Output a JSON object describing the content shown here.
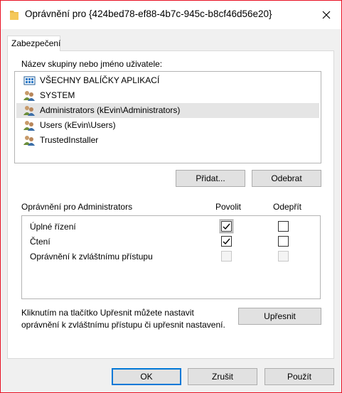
{
  "window": {
    "title": "Oprávnění pro {424bed78-ef88-4b7c-945c-b8cf46d56e20}",
    "icons": {
      "title": "folder-icon",
      "close": "close-icon"
    }
  },
  "tab": {
    "label": "Zabezpečení"
  },
  "groups": {
    "label": "Název skupiny nebo jméno uživatele:",
    "items": [
      {
        "name": "VŠECHNY BALÍČKY APLIKACÍ",
        "icon": "app-packages-icon",
        "selected": false
      },
      {
        "name": "SYSTEM",
        "icon": "user-group-icon",
        "selected": false
      },
      {
        "name": "Administrators (kEvin\\Administrators)",
        "icon": "user-group-icon",
        "selected": true
      },
      {
        "name": "Users (kEvin\\Users)",
        "icon": "user-group-icon",
        "selected": false
      },
      {
        "name": "TrustedInstaller",
        "icon": "user-group-icon",
        "selected": false
      }
    ],
    "add_label": "Přidat...",
    "remove_label": "Odebrat"
  },
  "permissions": {
    "header": "Oprávnění pro Administrators",
    "allow_header": "Povolit",
    "deny_header": "Odepřít",
    "rows": [
      {
        "name": "Úplné řízení",
        "allow": true,
        "deny": false,
        "enabled": true
      },
      {
        "name": "Čtení",
        "allow": true,
        "deny": false,
        "enabled": true
      },
      {
        "name": "Oprávnění k zvláštnímu přístupu",
        "allow": false,
        "deny": false,
        "enabled": false
      }
    ]
  },
  "advanced": {
    "note": "Kliknutím na tlačítko Upřesnit můžete nastavit oprávnění k zvláštnímu přístupu či upřesnit nastavení.",
    "button_label": "Upřesnit"
  },
  "footer": {
    "ok_label": "OK",
    "cancel_label": "Zrušit",
    "apply_label": "Použít"
  },
  "colors": {
    "accent": "#0078d7",
    "close_border": "#e81123",
    "selection": "#e5e5e5"
  }
}
